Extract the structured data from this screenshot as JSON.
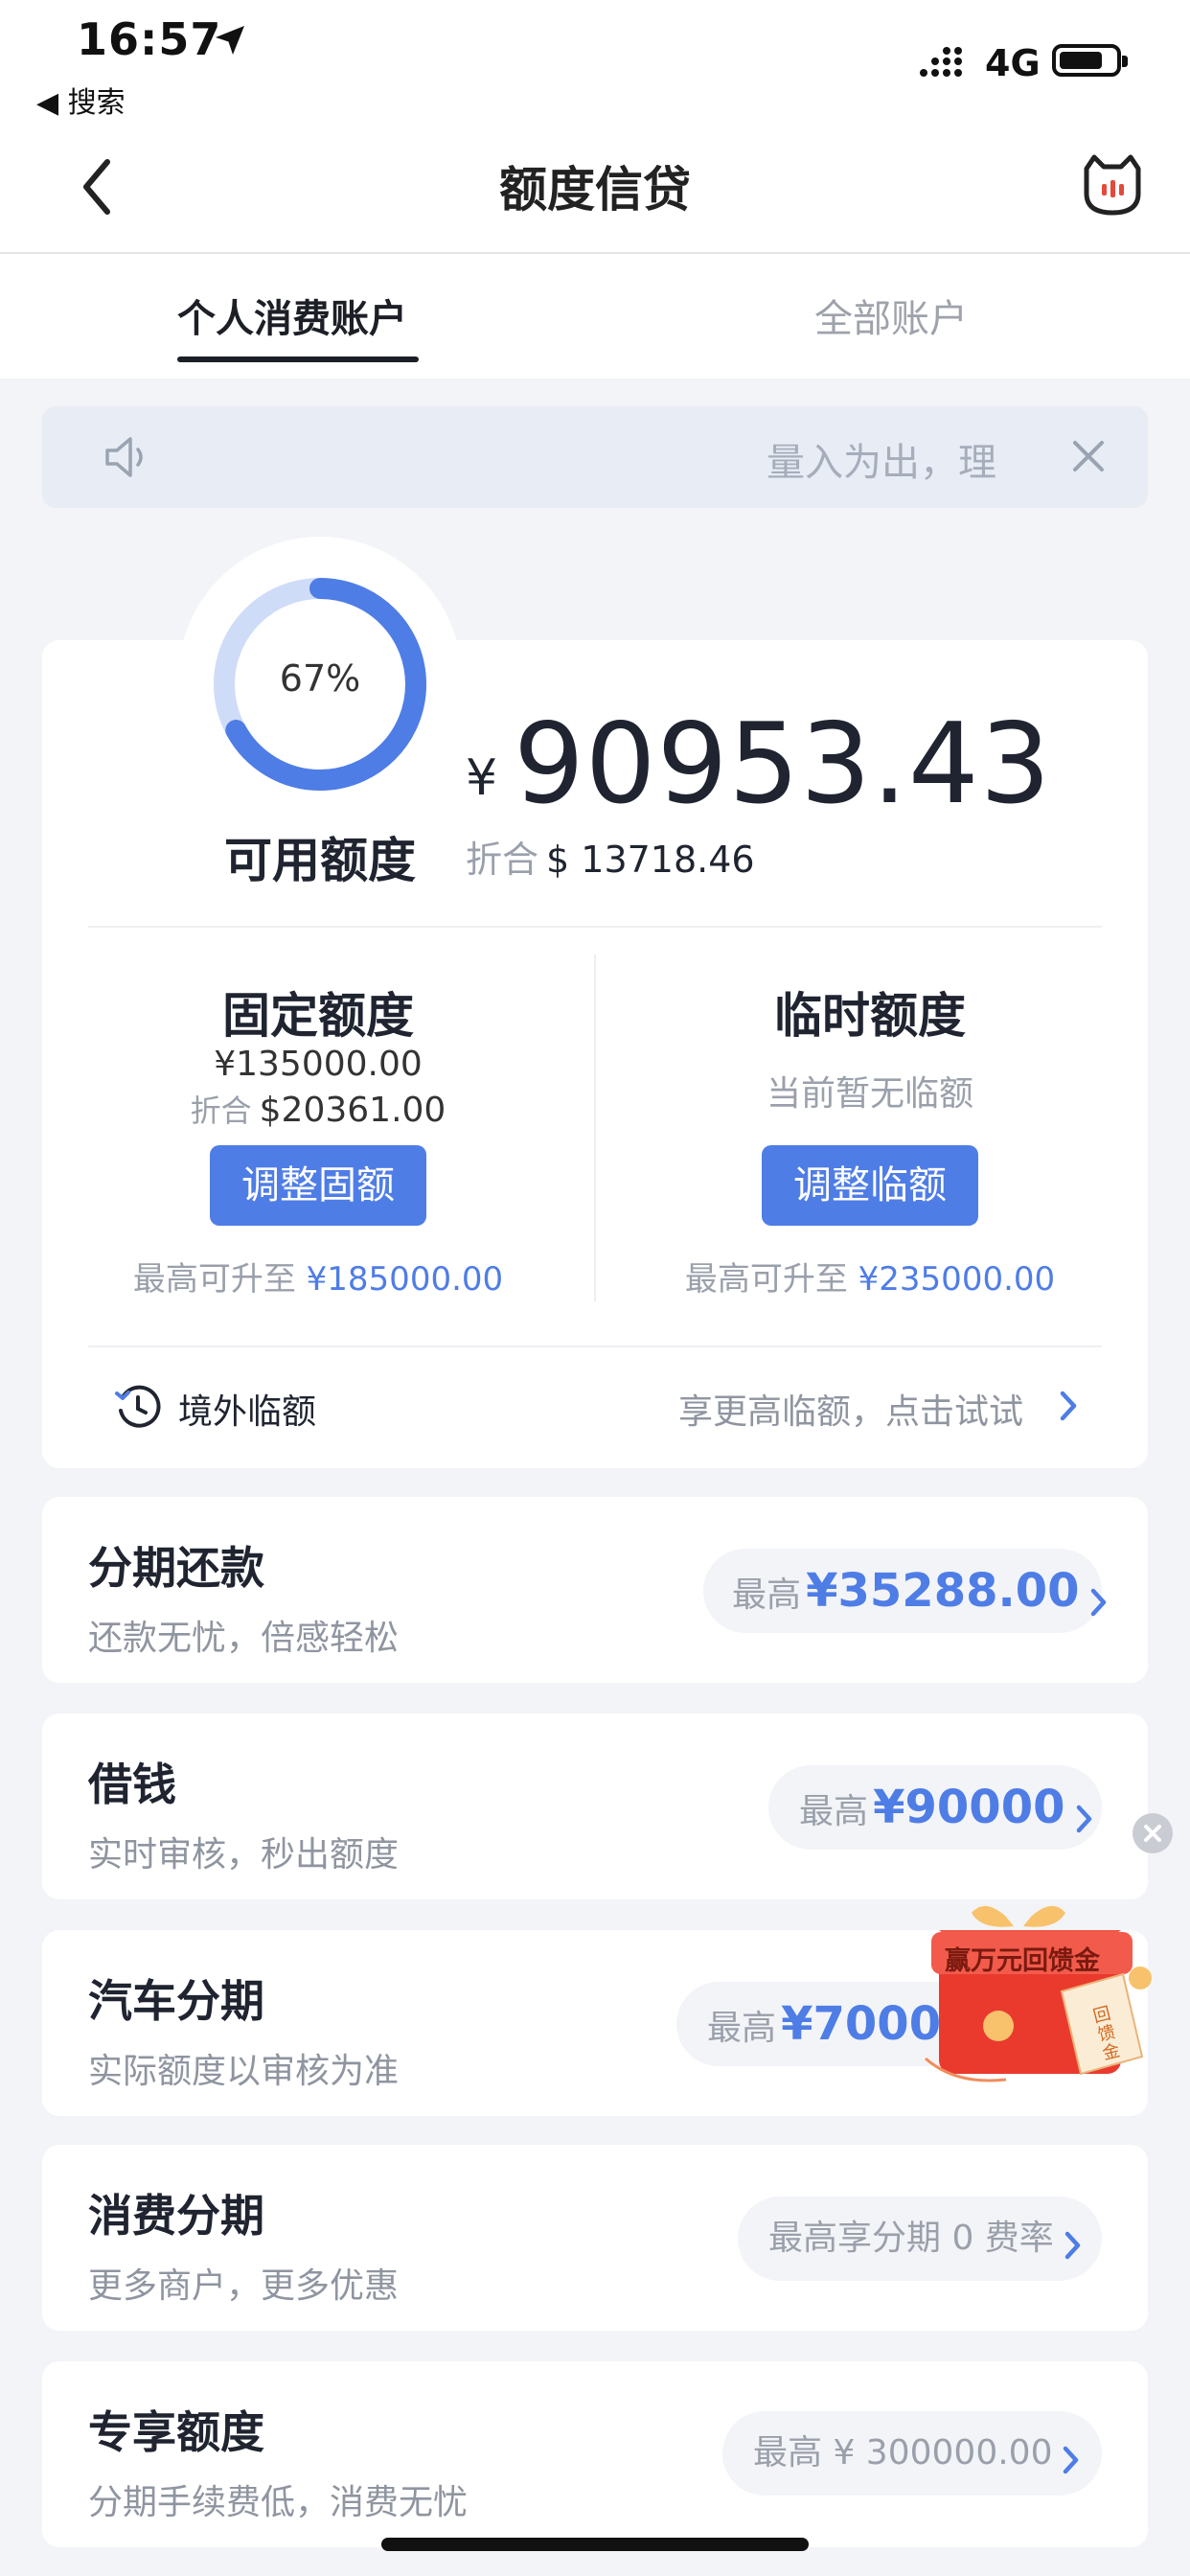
{
  "status_bar": {
    "time": "16:57",
    "back_app": "◀ 搜索",
    "network": "4G"
  },
  "nav": {
    "title": "额度信贷",
    "back_icon": "chevron-left-icon",
    "service_icon": "customer-service-icon"
  },
  "tabs": [
    {
      "label": "个人消费账户",
      "active": true
    },
    {
      "label": "全部账户",
      "active": false
    }
  ],
  "notice": {
    "text": "量入为出，理"
  },
  "credit": {
    "percent_label": "67%",
    "percent_value": 0.67,
    "available_label": "可用额度",
    "currency_symbol": "¥",
    "available_amount": "90953.43",
    "converted_prefix": "折合",
    "converted_amount": "$ 13718.46"
  },
  "fixed": {
    "title": "固定额度",
    "value": "¥135000.00",
    "converted_prefix": "折合",
    "converted_amount": "$20361.00",
    "button": "调整固额",
    "max_prefix": "最高可升至",
    "max_amount": "¥185000.00"
  },
  "temporary": {
    "title": "临时额度",
    "status": "当前暂无临额",
    "button": "调整临额",
    "max_prefix": "最高可升至",
    "max_amount": "¥235000.00"
  },
  "overseas": {
    "label": "境外临额",
    "hint": "享更高临额，点击试试"
  },
  "products": [
    {
      "title": "分期还款",
      "subtitle": "还款无忧，倍感轻松",
      "pill_prefix": "最高",
      "pill_amount": "¥35288.00"
    },
    {
      "title": "借钱",
      "subtitle": "实时审核，秒出额度",
      "pill_prefix": "最高",
      "pill_amount": "¥90000"
    },
    {
      "title": "汽车分期",
      "subtitle": "实际额度以审核为准",
      "pill_prefix": "最高",
      "pill_amount": "¥70000"
    },
    {
      "title": "消费分期",
      "subtitle": "更多商户，更多优惠",
      "pill_text": "最高享分期 0 费率"
    },
    {
      "title": "专享额度",
      "subtitle": "分期手续费低，消费无忧",
      "pill_text": "最高 ¥ 300000.00"
    }
  ],
  "promo": {
    "text": "赢万元回馈金",
    "ticket_text": "回馈金"
  },
  "colors": {
    "accent": "#4f7de6",
    "ring_track": "#cfdcf8",
    "background": "#f3f4f7"
  }
}
